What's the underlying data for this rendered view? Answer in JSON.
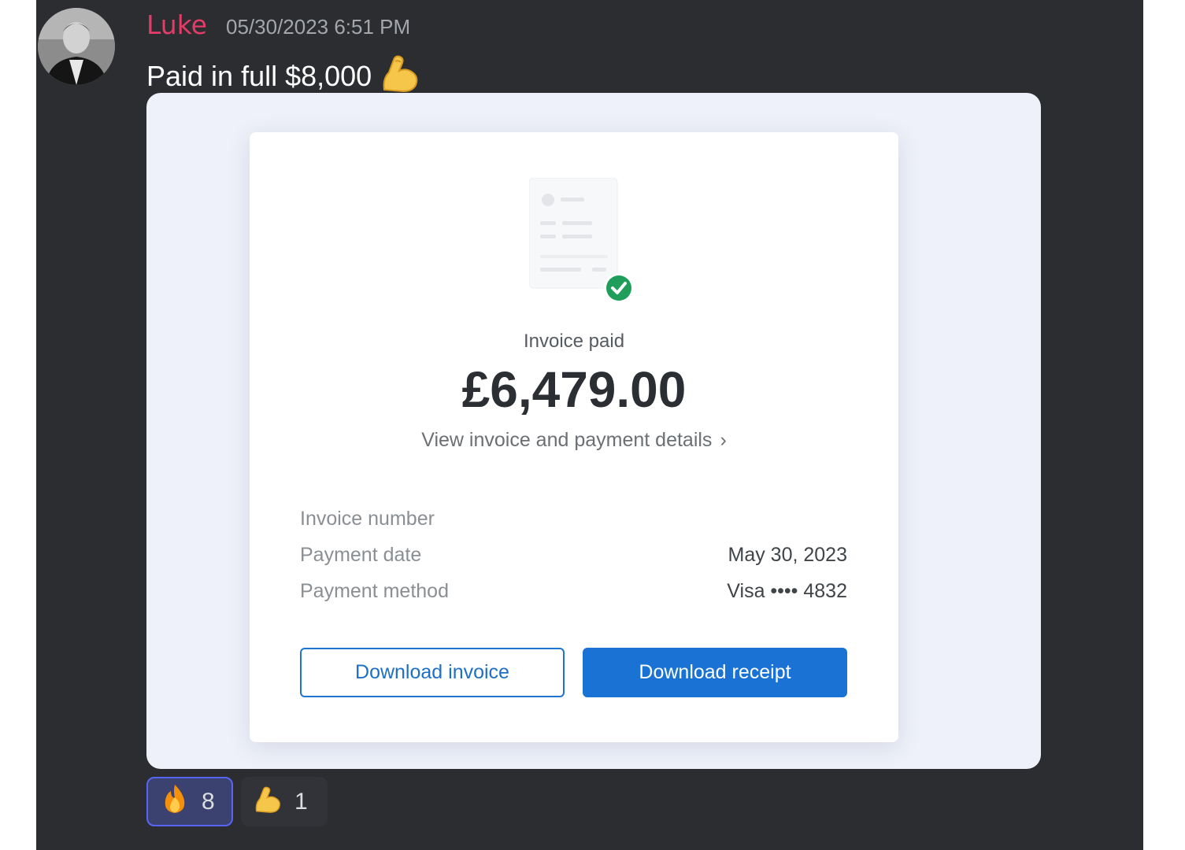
{
  "message": {
    "author": "Luke",
    "timestamp": "05/30/2023 6:51 PM",
    "text": "Paid in full $8,000",
    "text_emoji": "flexed-biceps"
  },
  "invoice_card": {
    "status": "Invoice paid",
    "amount": "£6,479.00",
    "details_link": "View invoice and payment details",
    "rows": [
      {
        "label": "Invoice number",
        "value": ""
      },
      {
        "label": "Payment date",
        "value": "May 30, 2023"
      },
      {
        "label": "Payment method",
        "value": "Visa •••• 4832"
      }
    ],
    "download_invoice_label": "Download invoice",
    "download_receipt_label": "Download receipt",
    "accent_color": "#1a73d4",
    "paid_check_color": "#1e9e5a"
  },
  "reactions": [
    {
      "emoji": "fire",
      "count": "8",
      "selected": true
    },
    {
      "emoji": "flexed-biceps",
      "count": "1",
      "selected": false
    }
  ],
  "colors": {
    "background": "#2b2d31",
    "username": "#e53b68",
    "timestamp": "#a3a6aa"
  }
}
